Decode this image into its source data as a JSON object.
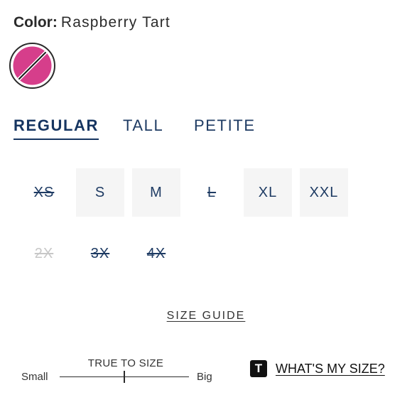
{
  "color": {
    "label": "Color:",
    "value": "Raspberry Tart",
    "swatch_color": "#d63e8b",
    "swatch_icon": "sale-slash-icon"
  },
  "tabs": [
    {
      "label": "REGULAR",
      "active": true
    },
    {
      "label": "TALL",
      "active": false
    },
    {
      "label": "PETITE",
      "active": false
    }
  ],
  "sizes": [
    {
      "label": "XS",
      "state": "unavailable"
    },
    {
      "label": "S",
      "state": "available"
    },
    {
      "label": "M",
      "state": "available"
    },
    {
      "label": "L",
      "state": "unavailable"
    },
    {
      "label": "XL",
      "state": "available"
    },
    {
      "label": "XXL",
      "state": "available"
    },
    {
      "label": "2X",
      "state": "disabled"
    },
    {
      "label": "3X",
      "state": "unavailable"
    },
    {
      "label": "4X",
      "state": "unavailable"
    }
  ],
  "size_guide": {
    "label": "SIZE GUIDE"
  },
  "fit_scale": {
    "title": "TRUE TO SIZE",
    "low_label": "Small",
    "high_label": "Big",
    "value": 0.5
  },
  "whats_my_size": {
    "badge": "T",
    "label": "WHAT'S MY SIZE?",
    "icon": "true-fit-logo-icon"
  },
  "colors": {
    "accent": "#163561",
    "text": "#1e3b63",
    "swatch": "#d63e8b",
    "available_bg": "#f5f5f5",
    "disabled_text": "#c7c7c7"
  }
}
